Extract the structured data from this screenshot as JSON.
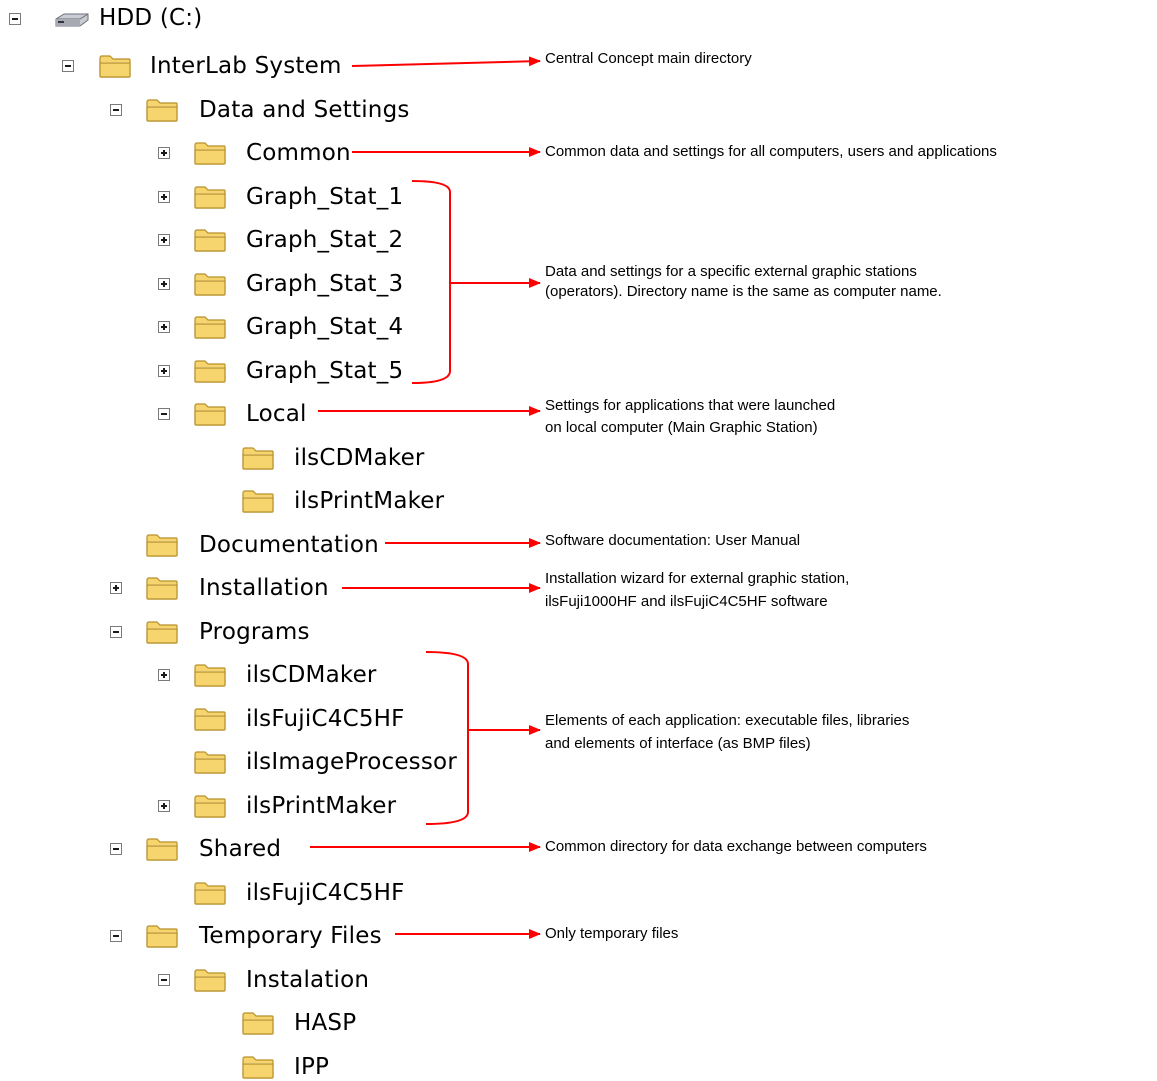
{
  "tree": {
    "drive_label": "HDD (C:)",
    "items": [
      {
        "label": "InterLab System",
        "toggle": "minus"
      },
      {
        "label": "Data and Settings",
        "toggle": "minus"
      },
      {
        "label": "Common",
        "toggle": "plus"
      },
      {
        "label": "Graph_Stat_1",
        "toggle": "plus"
      },
      {
        "label": "Graph_Stat_2",
        "toggle": "plus"
      },
      {
        "label": "Graph_Stat_3",
        "toggle": "plus"
      },
      {
        "label": "Graph_Stat_4",
        "toggle": "plus"
      },
      {
        "label": "Graph_Stat_5",
        "toggle": "plus"
      },
      {
        "label": "Local",
        "toggle": "minus"
      },
      {
        "label": "ilsCDMaker",
        "toggle": "none"
      },
      {
        "label": "ilsPrintMaker",
        "toggle": "none"
      },
      {
        "label": "Documentation",
        "toggle": "none"
      },
      {
        "label": "Installation",
        "toggle": "plus"
      },
      {
        "label": "Programs",
        "toggle": "minus"
      },
      {
        "label": "ilsCDMaker",
        "toggle": "plus"
      },
      {
        "label": "ilsFujiC4C5HF",
        "toggle": "none"
      },
      {
        "label": "ilsImageProcessor",
        "toggle": "none"
      },
      {
        "label": "ilsPrintMaker",
        "toggle": "plus"
      },
      {
        "label": "Shared",
        "toggle": "minus"
      },
      {
        "label": "ilsFujiC4C5HF",
        "toggle": "none"
      },
      {
        "label": "Temporary Files",
        "toggle": "minus"
      },
      {
        "label": "Instalation",
        "toggle": "minus"
      },
      {
        "label": "HASP",
        "toggle": "none"
      },
      {
        "label": "IPP",
        "toggle": "none"
      }
    ]
  },
  "annotations": {
    "main_dir": "Central Concept main directory",
    "common": "Common data and settings for all computers, users and applications",
    "graph_stations_line1": "Data and settings for a specific external graphic stations",
    "graph_stations_line2": "(operators). Directory name is the same as computer name.",
    "local_line1": "Settings for applications that were launched",
    "local_line2": "on local computer (Main Graphic Station)",
    "documentation": "Software documentation: User Manual",
    "installation_line1": "Installation wizard for external graphic station,",
    "installation_line2": "ilsFuji1000HF and ilsFujiC4C5HF software",
    "programs_line1": "Elements of each application: executable files, libraries",
    "programs_line2": "and elements of interface (as BMP files)",
    "shared": "Common directory for data exchange between computers",
    "temporary": "Only temporary files"
  },
  "colors": {
    "arrow": "#ff0000",
    "folder_fill": "#f6d56f",
    "folder_edge": "#b8902b"
  }
}
